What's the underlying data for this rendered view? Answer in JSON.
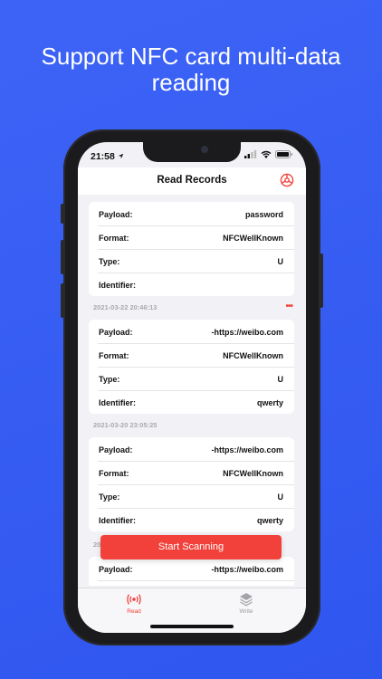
{
  "headline": {
    "line1": "Support NFC card multi-data",
    "line2": "reading"
  },
  "status_bar": {
    "time": "21:58"
  },
  "nav": {
    "title": "Read Records",
    "settings_icon": "settings-icon"
  },
  "records": [
    {
      "rows": [
        {
          "label": "Payload:",
          "value": "password"
        },
        {
          "label": "Format:",
          "value": "NFCWellKnown"
        },
        {
          "label": "Type:",
          "value": "U"
        },
        {
          "label": "Identifier:",
          "value": ""
        }
      ],
      "date": "2021-03-22 20:46:13",
      "more": "•••"
    },
    {
      "rows": [
        {
          "label": "Payload:",
          "value": "-https://weibo.com"
        },
        {
          "label": "Format:",
          "value": "NFCWellKnown"
        },
        {
          "label": "Type:",
          "value": "U"
        },
        {
          "label": "Identifier:",
          "value": "qwerty"
        }
      ],
      "date": "2021-03-20 23:05:25"
    },
    {
      "rows": [
        {
          "label": "Payload:",
          "value": "-https://weibo.com"
        },
        {
          "label": "Format:",
          "value": "NFCWellKnown"
        },
        {
          "label": "Type:",
          "value": "U"
        },
        {
          "label": "Identifier:",
          "value": "qwerty"
        }
      ],
      "date": "20"
    },
    {
      "rows": [
        {
          "label": "Payload:",
          "value": "-https://weibo.com"
        }
      ]
    }
  ],
  "scan_button": "Start Scanning",
  "tabs": [
    {
      "label": "Read",
      "icon": "nfc-read-icon",
      "active": true
    },
    {
      "label": "Write",
      "icon": "layers-icon",
      "active": false
    }
  ],
  "colors": {
    "background": "#3d63f6",
    "accent": "#f2413a",
    "inactive_tab": "#9a9aa0"
  }
}
